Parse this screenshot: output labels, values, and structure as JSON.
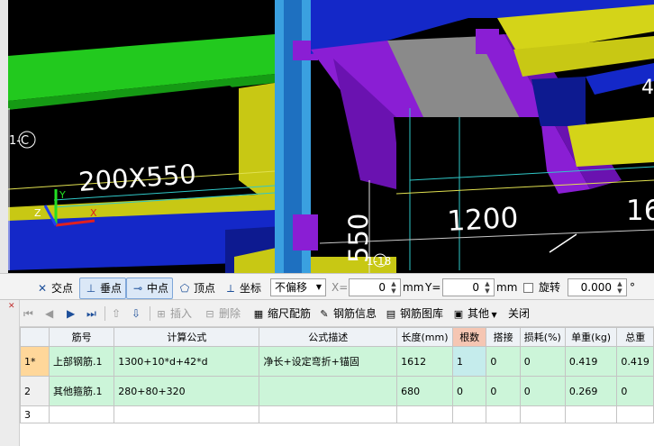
{
  "viewport": {
    "labels": {
      "beam_size": "200X550",
      "dim_1200": "1200",
      "dim_16": "16",
      "dim_550": "550",
      "dim_4": "4",
      "grid_1c": "1-C",
      "grid_1_18": "1-18"
    },
    "axes": {
      "x": "X",
      "y": "Y",
      "z": "Z"
    },
    "colors": {
      "green": "#22c91e",
      "yellow": "#d4d418",
      "blue": "#1428c8",
      "purple": "#8a1ed4",
      "gray": "#8a8a8a",
      "black": "#000000",
      "cyan_column": "#3aa0e0"
    }
  },
  "snapbar": {
    "intersection": "交点",
    "perpendicular": "垂点",
    "midpoint": "中点",
    "vertex": "顶点",
    "coordinate": "坐标",
    "offset_select": "不偏移",
    "x_label": "X=",
    "x_value": "0",
    "x_unit": "mm",
    "y_label": "Y=",
    "y_value": "0",
    "y_unit": "mm",
    "rotate_label": "旋转",
    "rotate_value": "0.000",
    "degree": "°"
  },
  "toolbar": {
    "insert": "插入",
    "delete": "删除",
    "scale_rebar": "缩尺配筋",
    "rebar_info": "钢筋信息",
    "rebar_library": "钢筋图库",
    "other": "其他",
    "close": "关闭"
  },
  "table": {
    "headers": [
      "筋号",
      "计算公式",
      "公式描述",
      "长度(mm)",
      "根数",
      "搭接",
      "损耗(%)",
      "单重(kg)",
      "总重"
    ],
    "rows": [
      {
        "num": "1*",
        "name": "上部钢筋.1",
        "formula": "1300+10*d+42*d",
        "desc": "净长+设定弯折+锚固",
        "length": "1612",
        "count": "1",
        "lap": "0",
        "loss": "0",
        "unit_weight": "0.419",
        "total": "0.419"
      },
      {
        "num": "2",
        "name": "其他箍筋.1",
        "formula": "280+80+320",
        "desc": "",
        "length": "680",
        "count": "0",
        "lap": "0",
        "loss": "0",
        "unit_weight": "0.269",
        "total": "0"
      },
      {
        "num": "3",
        "name": "",
        "formula": "",
        "desc": "",
        "length": "",
        "count": "",
        "lap": "",
        "loss": "",
        "unit_weight": "",
        "total": ""
      }
    ]
  }
}
